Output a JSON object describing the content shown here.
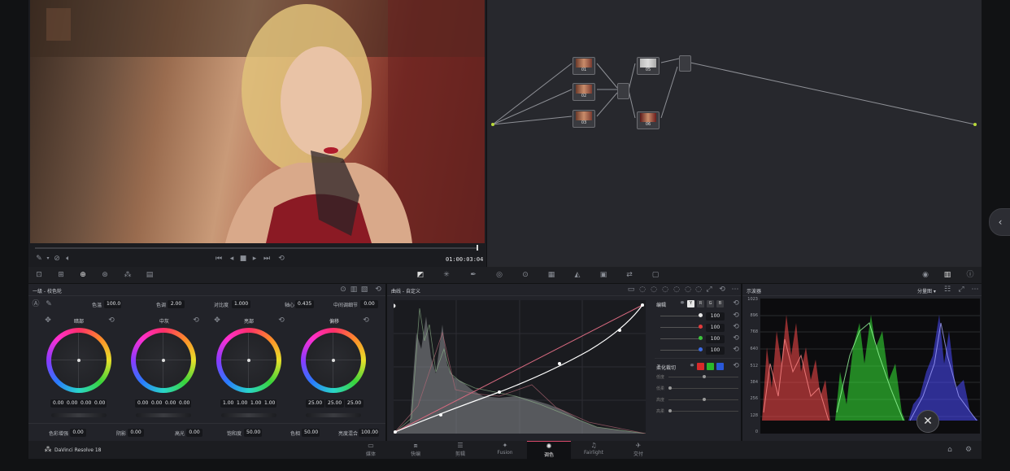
{
  "viewer": {
    "timecode": "01:00:03:04"
  },
  "color_wheels": {
    "panel_title": "一级 - 校色轮",
    "params_top": [
      {
        "label": "色温",
        "value": "100.0"
      },
      {
        "label": "色调",
        "value": "2.00"
      },
      {
        "label": "对比度",
        "value": "1.000"
      },
      {
        "label": "轴心",
        "value": "0.435"
      },
      {
        "label": "中间调细节",
        "value": "0.00"
      }
    ],
    "wheels": [
      {
        "name": "暗部",
        "values": [
          "0.00",
          "0.00",
          "0.00",
          "0.00"
        ]
      },
      {
        "name": "中灰",
        "values": [
          "0.00",
          "0.00",
          "0.00",
          "0.00"
        ]
      },
      {
        "name": "亮部",
        "values": [
          "1.00",
          "1.00",
          "1.00",
          "1.00"
        ]
      },
      {
        "name": "偏移",
        "values": [
          "25.00",
          "25.00",
          "25.00"
        ]
      }
    ],
    "params_bottom": [
      {
        "label": "色彩增强",
        "value": "0.00"
      },
      {
        "label": "阴影",
        "value": "0.00"
      },
      {
        "label": "高光",
        "value": "0.00"
      },
      {
        "label": "饱和度",
        "value": "50.00"
      },
      {
        "label": "色相",
        "value": "50.00"
      },
      {
        "label": "亮度混合",
        "value": "100.00"
      }
    ]
  },
  "curves": {
    "panel_title": "曲线 - 自定义",
    "side_title": "编辑",
    "channels": [
      "Y",
      "R",
      "G",
      "B"
    ],
    "intensity": [
      "100",
      "100",
      "100",
      "100"
    ],
    "soft_clip_title": "柔化裁切",
    "soft_clip_labels": [
      "低度",
      "低柔",
      "高度",
      "高柔"
    ]
  },
  "scopes": {
    "panel_title": "示波器",
    "mode": "分量图",
    "scale": [
      "1023",
      "896",
      "768",
      "640",
      "512",
      "384",
      "256",
      "128",
      "0"
    ]
  },
  "nodes": {
    "labels": [
      "01",
      "02",
      "03",
      "05",
      "06"
    ]
  },
  "app": {
    "name": "DaVinci Resolve 18"
  },
  "pages": [
    {
      "label": "媒体",
      "icon": "▭"
    },
    {
      "label": "快编",
      "icon": "⧈"
    },
    {
      "label": "剪辑",
      "icon": "☰"
    },
    {
      "label": "Fusion",
      "icon": "✦"
    },
    {
      "label": "调色",
      "icon": "✺",
      "active": true
    },
    {
      "label": "Fairlight",
      "icon": "♫"
    },
    {
      "label": "交付",
      "icon": "✈"
    }
  ]
}
